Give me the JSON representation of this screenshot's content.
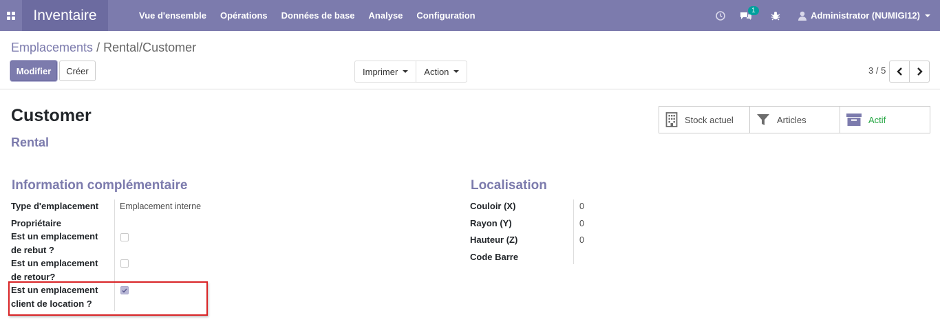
{
  "navbar": {
    "app_name": "Inventaire",
    "menu": [
      "Vue d'ensemble",
      "Opérations",
      "Données de base",
      "Analyse",
      "Configuration"
    ],
    "messages_count": "1",
    "user": "Administrator (NUMIGI12)"
  },
  "breadcrumb": {
    "parent": "Emplacements",
    "separator": "/",
    "current": "Rental/Customer"
  },
  "buttons": {
    "edit": "Modifier",
    "create": "Créer",
    "print": "Imprimer",
    "action": "Action"
  },
  "pager": {
    "value": "3 / 5"
  },
  "record": {
    "title": "Customer",
    "subtitle": "Rental",
    "smart_buttons": {
      "stock": "Stock actuel",
      "articles": "Articles",
      "active": "Actif"
    }
  },
  "info": {
    "title": "Information complémentaire",
    "location_type_label": "Type d'emplacement",
    "location_type_value": "Emplacement interne",
    "owner_label": "Propriétaire",
    "scrap_label_1": "Est un emplacement",
    "scrap_label_2": "de rebut ?",
    "scrap_checked": false,
    "return_label_1": "Est un emplacement",
    "return_label_2": "de retour?",
    "return_checked": false,
    "rental_label_1": "Est un emplacement",
    "rental_label_2": "client de location ?",
    "rental_checked": true
  },
  "localisation": {
    "title": "Localisation",
    "corridor_label": "Couloir (X)",
    "corridor_value": "0",
    "shelf_label": "Rayon (Y)",
    "shelf_value": "0",
    "height_label": "Hauteur (Z)",
    "height_value": "0",
    "barcode_label": "Code Barre",
    "barcode_value": ""
  },
  "colors": {
    "navbar": "#7c7bad",
    "brand": "#6c6ba0",
    "accent": "#7c7bad",
    "active_green": "#28a745",
    "highlight": "#d92426"
  }
}
